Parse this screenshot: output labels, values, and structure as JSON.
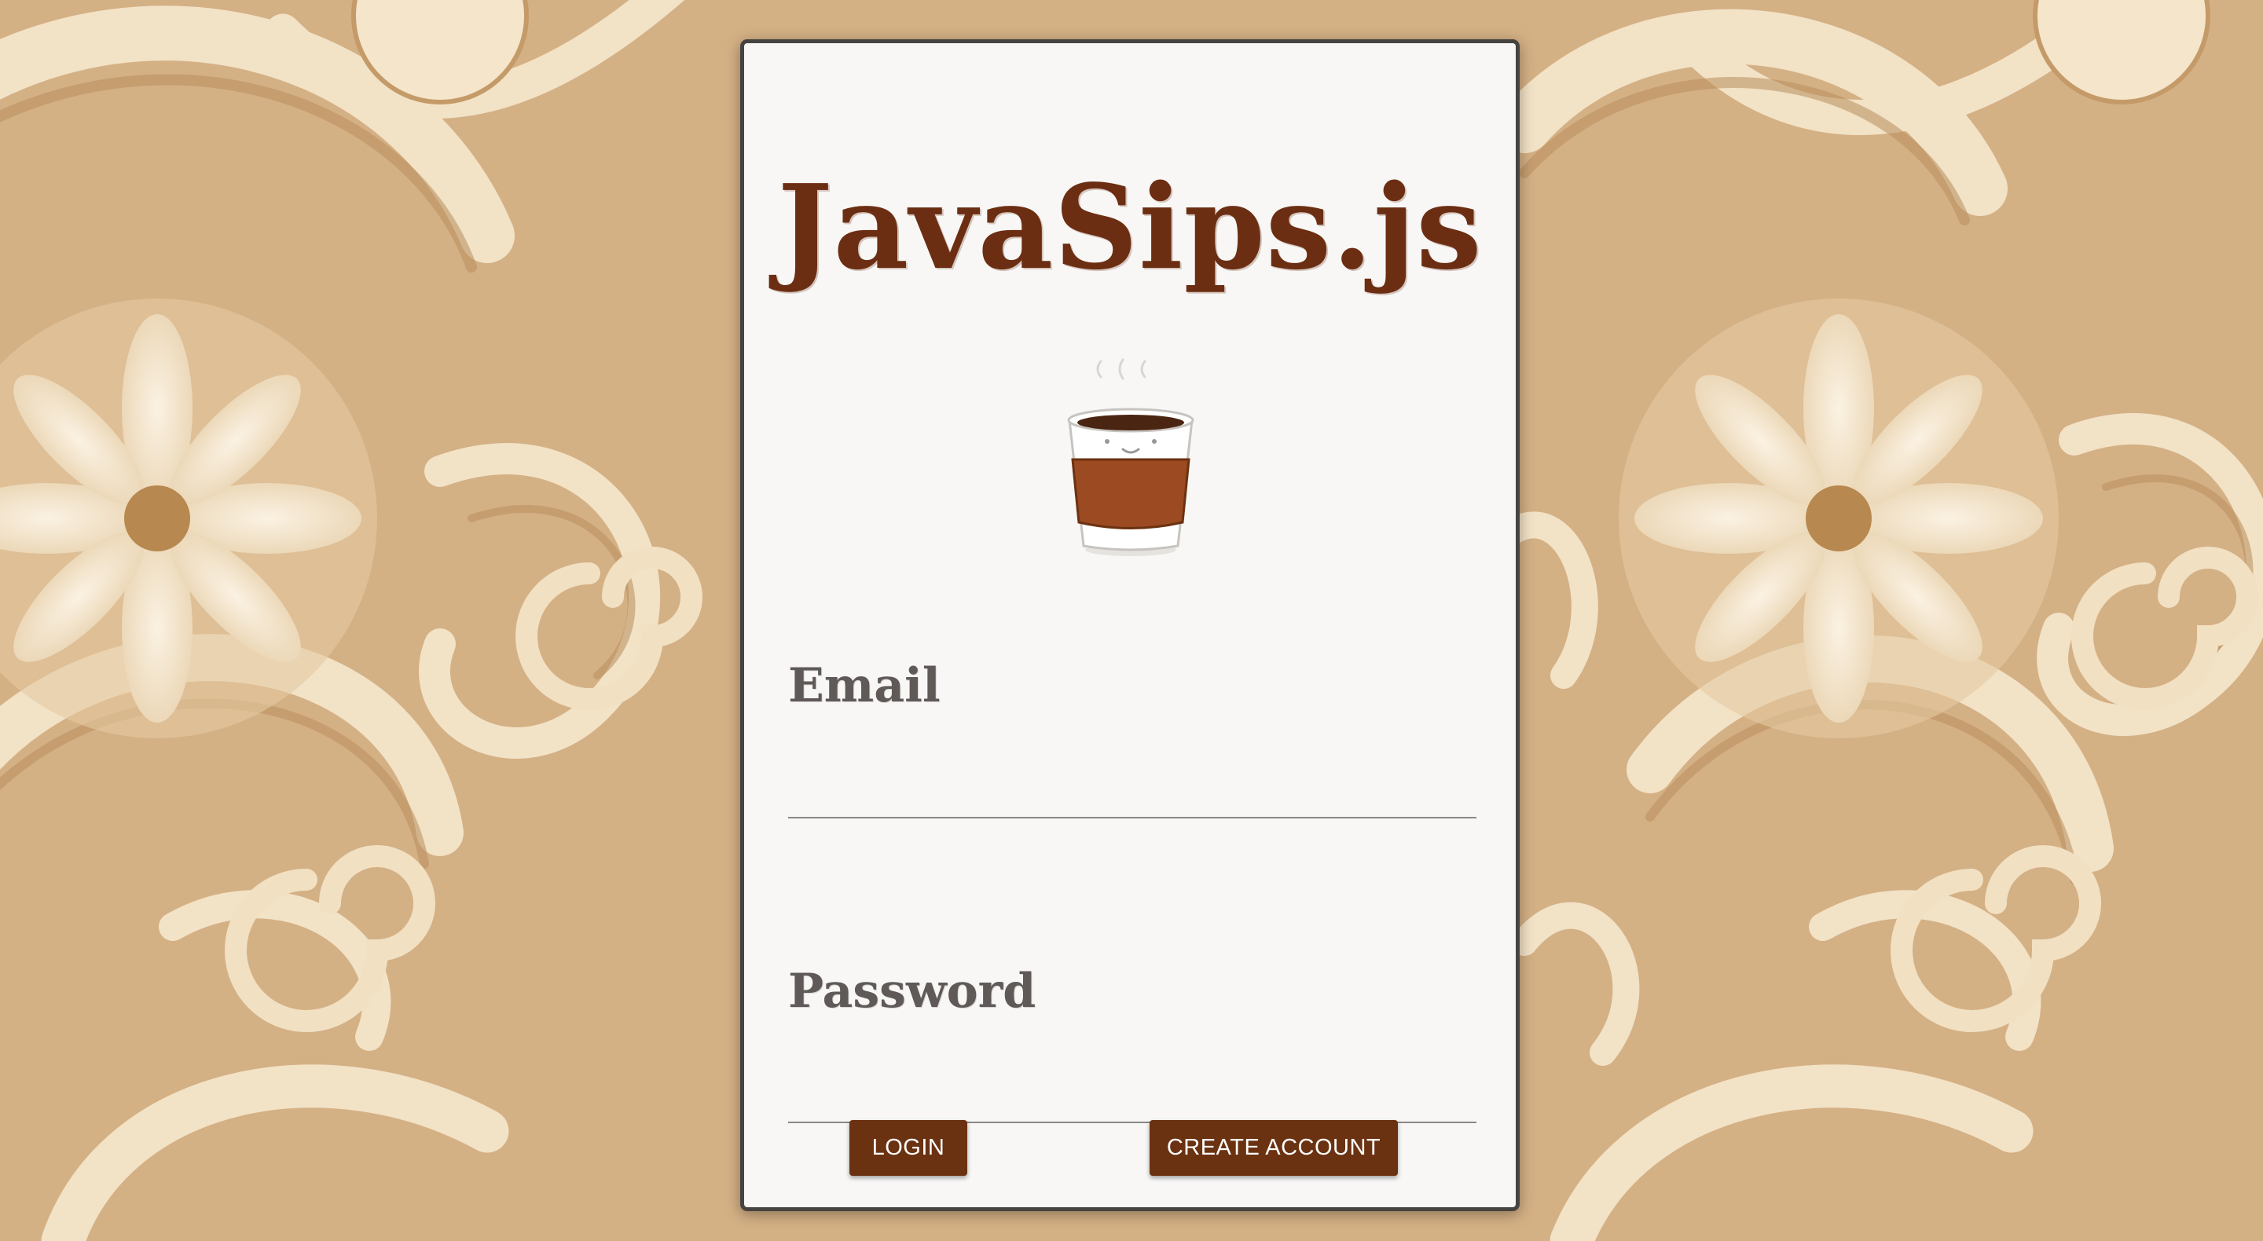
{
  "login": {
    "title": "JavaSips.js",
    "email_label": "Email",
    "email_value": "",
    "password_label": "Password",
    "password_value": "",
    "login_button": "LOGIN",
    "create_account_button": "CREATE ACCOUNT"
  },
  "icons": {
    "logo": "coffee-cup-icon",
    "background": "swirl-floral-pattern"
  },
  "colors": {
    "brand": "#6b2e12",
    "button": "#6b3211",
    "card": "#f8f7f6",
    "card_border": "#474341",
    "label": "#5f5a57",
    "background": "#d4b085"
  }
}
